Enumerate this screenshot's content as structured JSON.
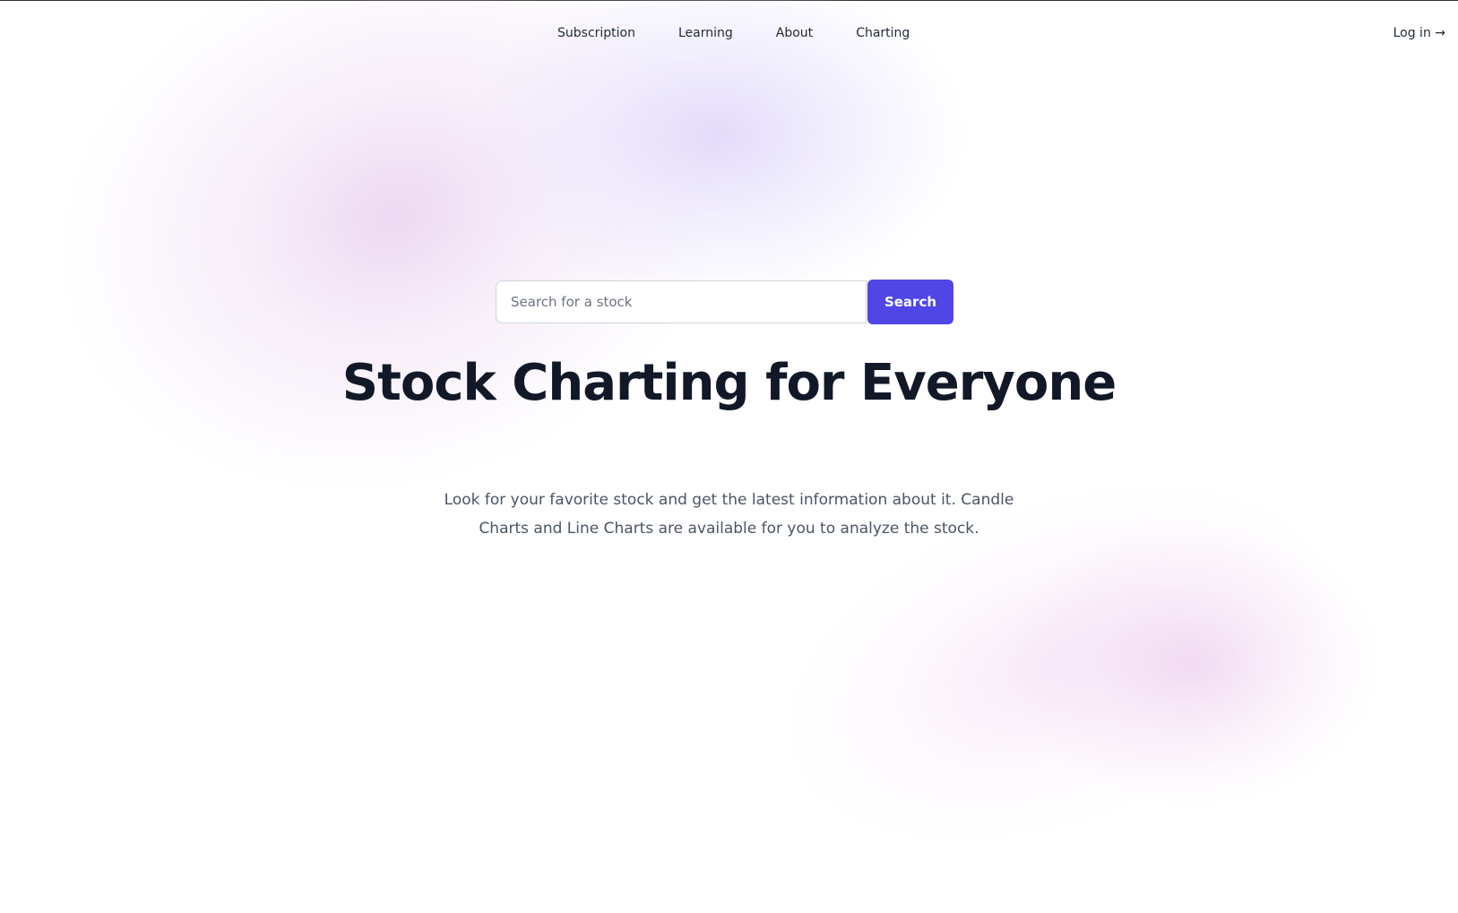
{
  "nav": {
    "links": [
      {
        "label": "Subscription"
      },
      {
        "label": "Learning"
      },
      {
        "label": "About"
      },
      {
        "label": "Charting"
      }
    ],
    "login_label": "Log in →"
  },
  "search": {
    "placeholder": "Search for a stock",
    "value": "",
    "button_label": "Search"
  },
  "hero": {
    "title": "Stock Charting for Everyone",
    "subtitle": "Look for your favorite stock and get the latest information about it. Candle Charts and Line Charts are available for you to analyze the stock."
  },
  "colors": {
    "accent": "#4f46e5",
    "heading": "#111827",
    "body_text": "#4b5563"
  }
}
